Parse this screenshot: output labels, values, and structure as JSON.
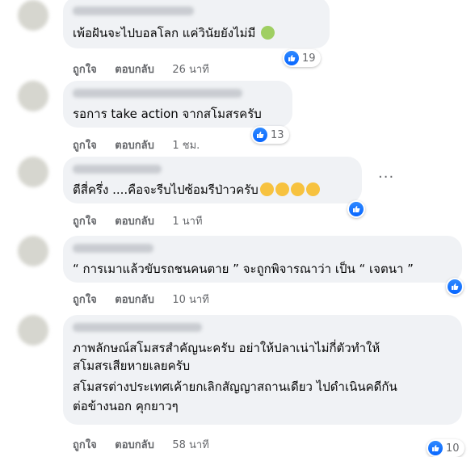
{
  "comments": [
    {
      "text_lines": [
        "เพ้อฝันจะไปบอลโลก แค่วินัยยังไม่มี"
      ],
      "emoji": "sick",
      "like_label": "ถูกใจ",
      "reply_label": "ตอบกลับ",
      "time": "26 นาที",
      "reaction_count": "19"
    },
    {
      "text_lines": [
        "รอการ take action จากสโมสรครับ"
      ],
      "like_label": "ถูกใจ",
      "reply_label": "ตอบกลับ",
      "time": "1 ชม.",
      "reaction_count": "13"
    },
    {
      "text_lines": [
        "ตีสี่ครึ่ง ....คือจะรีบไปซ้อมรีป่าวครับ"
      ],
      "emoji": "laughing x4",
      "like_label": "ถูกใจ",
      "reply_label": "ตอบกลับ",
      "time": "1 นาที",
      "reaction_count": ""
    },
    {
      "text_lines": [
        "“ การเมาแล้วขับรถชนคนตาย ” จะถูกพิจารณาว่า เป็น “ เจตนา ”"
      ],
      "like_label": "ถูกใจ",
      "reply_label": "ตอบกลับ",
      "time": "10 นาที",
      "reaction_count": ""
    },
    {
      "text_lines": [
        "ภาพลักษณ์สโมสรสำคัญนะครับ อย่าให้ปลาเน่าไม่กี่ตัวทำให้",
        "สโมสรเสียหายเลยครับ",
        "สโมสรต่างประเทศเค้ายกเลิกสัญญาสถานเดียว ไปดำเนินคดีกัน",
        "ต่อข้างนอก คุกยาวๆ"
      ],
      "like_label": "ถูกใจ",
      "reply_label": "ตอบกลับ",
      "time": "58 นาที",
      "reaction_count": "10"
    }
  ],
  "colors": {
    "bubble": "#f0f2f5",
    "meta_text": "#65676b",
    "like_blue": "#0866ff"
  },
  "icons": [
    "like-icon",
    "more-options-icon",
    "sick-face-emoji",
    "laughing-emoji"
  ]
}
